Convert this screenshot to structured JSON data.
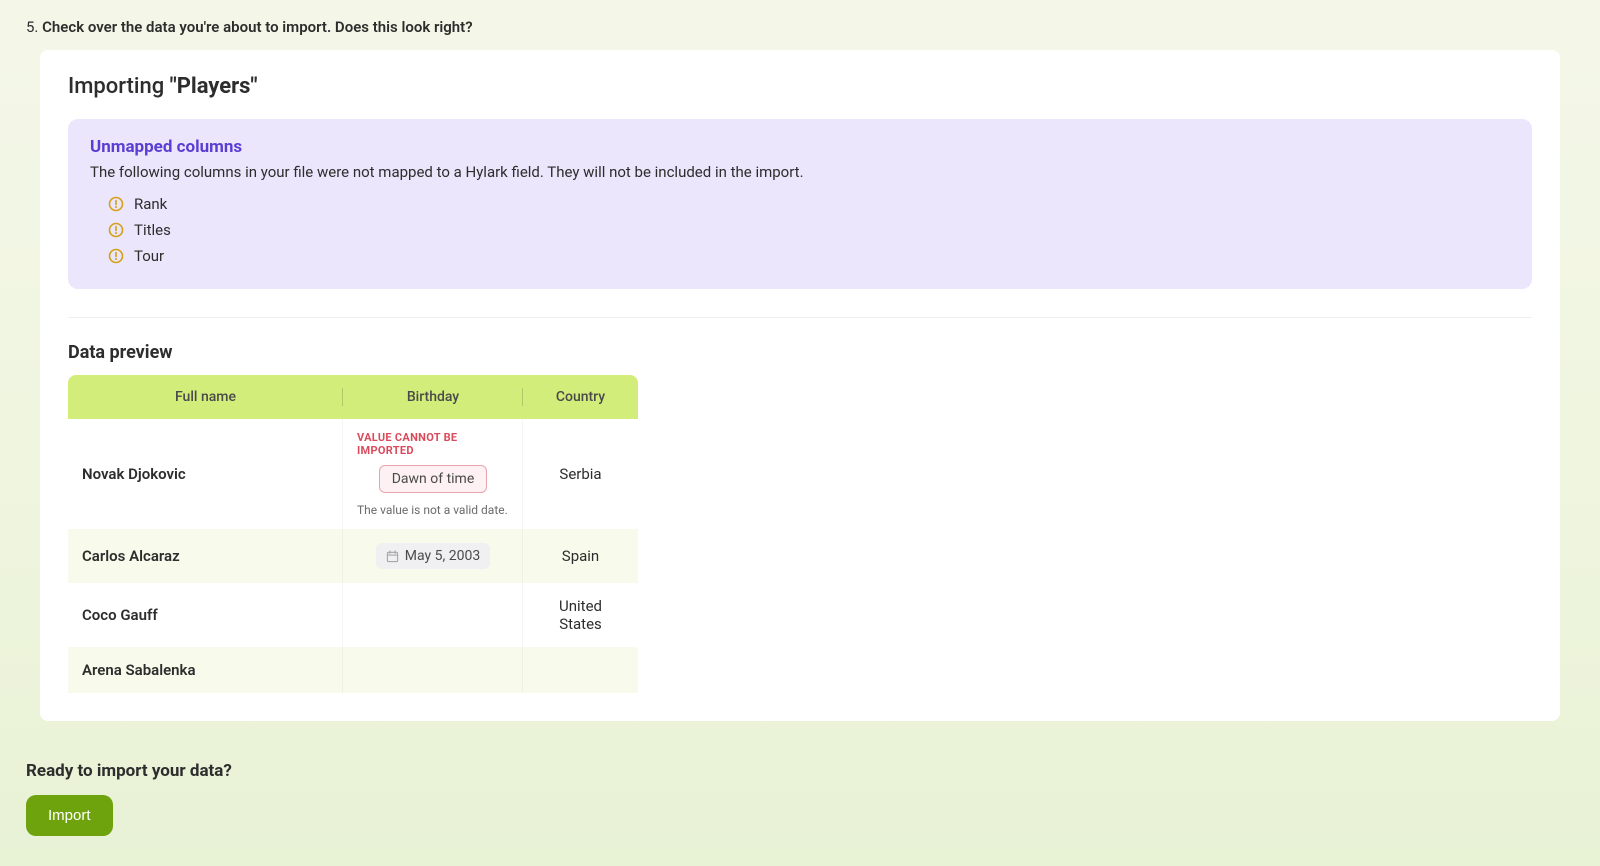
{
  "step": {
    "number": "5.",
    "text": "Check over the data you're about to import. Does this look right?"
  },
  "importing": {
    "prefix": "Importing ",
    "name": "\"Players\""
  },
  "alert": {
    "title": "Unmapped columns",
    "description": "The following columns in your file were not mapped to a Hylark field. They will not be included in the import.",
    "items": [
      "Rank",
      "Titles",
      "Tour"
    ]
  },
  "preview": {
    "title": "Data preview",
    "columns": [
      "Full name",
      "Birthday",
      "Country"
    ],
    "rows": [
      {
        "name": "Novak Djokovic",
        "birthday_error": {
          "label": "VALUE CANNOT BE IMPORTED",
          "value": "Dawn of time",
          "hint": "The value is not a valid date."
        },
        "country": "Serbia"
      },
      {
        "name": "Carlos Alcaraz",
        "birthday": "May 5, 2003",
        "country": "Spain"
      },
      {
        "name": "Coco Gauff",
        "birthday": "",
        "country": "United States"
      },
      {
        "name": "Arena Sabalenka",
        "birthday": "",
        "country": ""
      }
    ]
  },
  "footer": {
    "prompt": "Ready to import your data?",
    "button": "Import"
  }
}
